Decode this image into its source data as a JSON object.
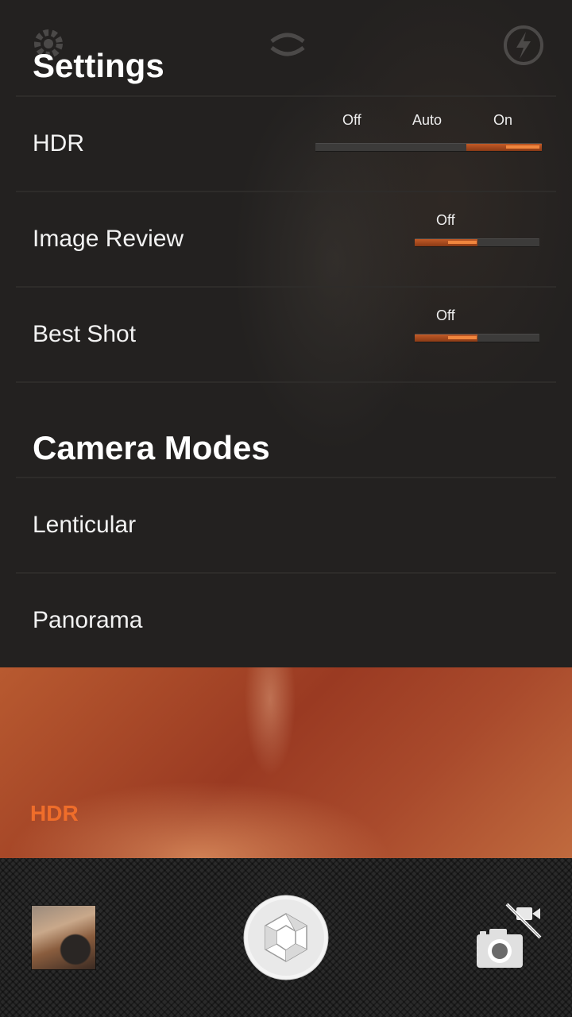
{
  "colors": {
    "accent": "#EF6D2A",
    "panel_bg": "#1E1D1C",
    "divider": "#2E2C2A",
    "toolbar_bg": "#2A2A2A"
  },
  "top_icons": [
    "gear-icon",
    "switch-camera-icon",
    "flash-icon"
  ],
  "settings": {
    "title": "Settings",
    "hdr": {
      "label": "HDR",
      "options": [
        "Off",
        "Auto",
        "On"
      ],
      "selected": "On"
    },
    "image_review": {
      "label": "Image Review",
      "state_label": "Off"
    },
    "best_shot": {
      "label": "Best Shot",
      "state_label": "Off"
    }
  },
  "camera_modes": {
    "title": "Camera Modes",
    "items": [
      {
        "label": "Lenticular"
      },
      {
        "label": "Panorama"
      }
    ]
  },
  "preview": {
    "hdr_indicator": "HDR"
  },
  "toolbar": {
    "thumbnail": "last-photo-thumbnail",
    "shutter": "shutter-icon",
    "mode_switch": "camera-video-switch-icon"
  }
}
